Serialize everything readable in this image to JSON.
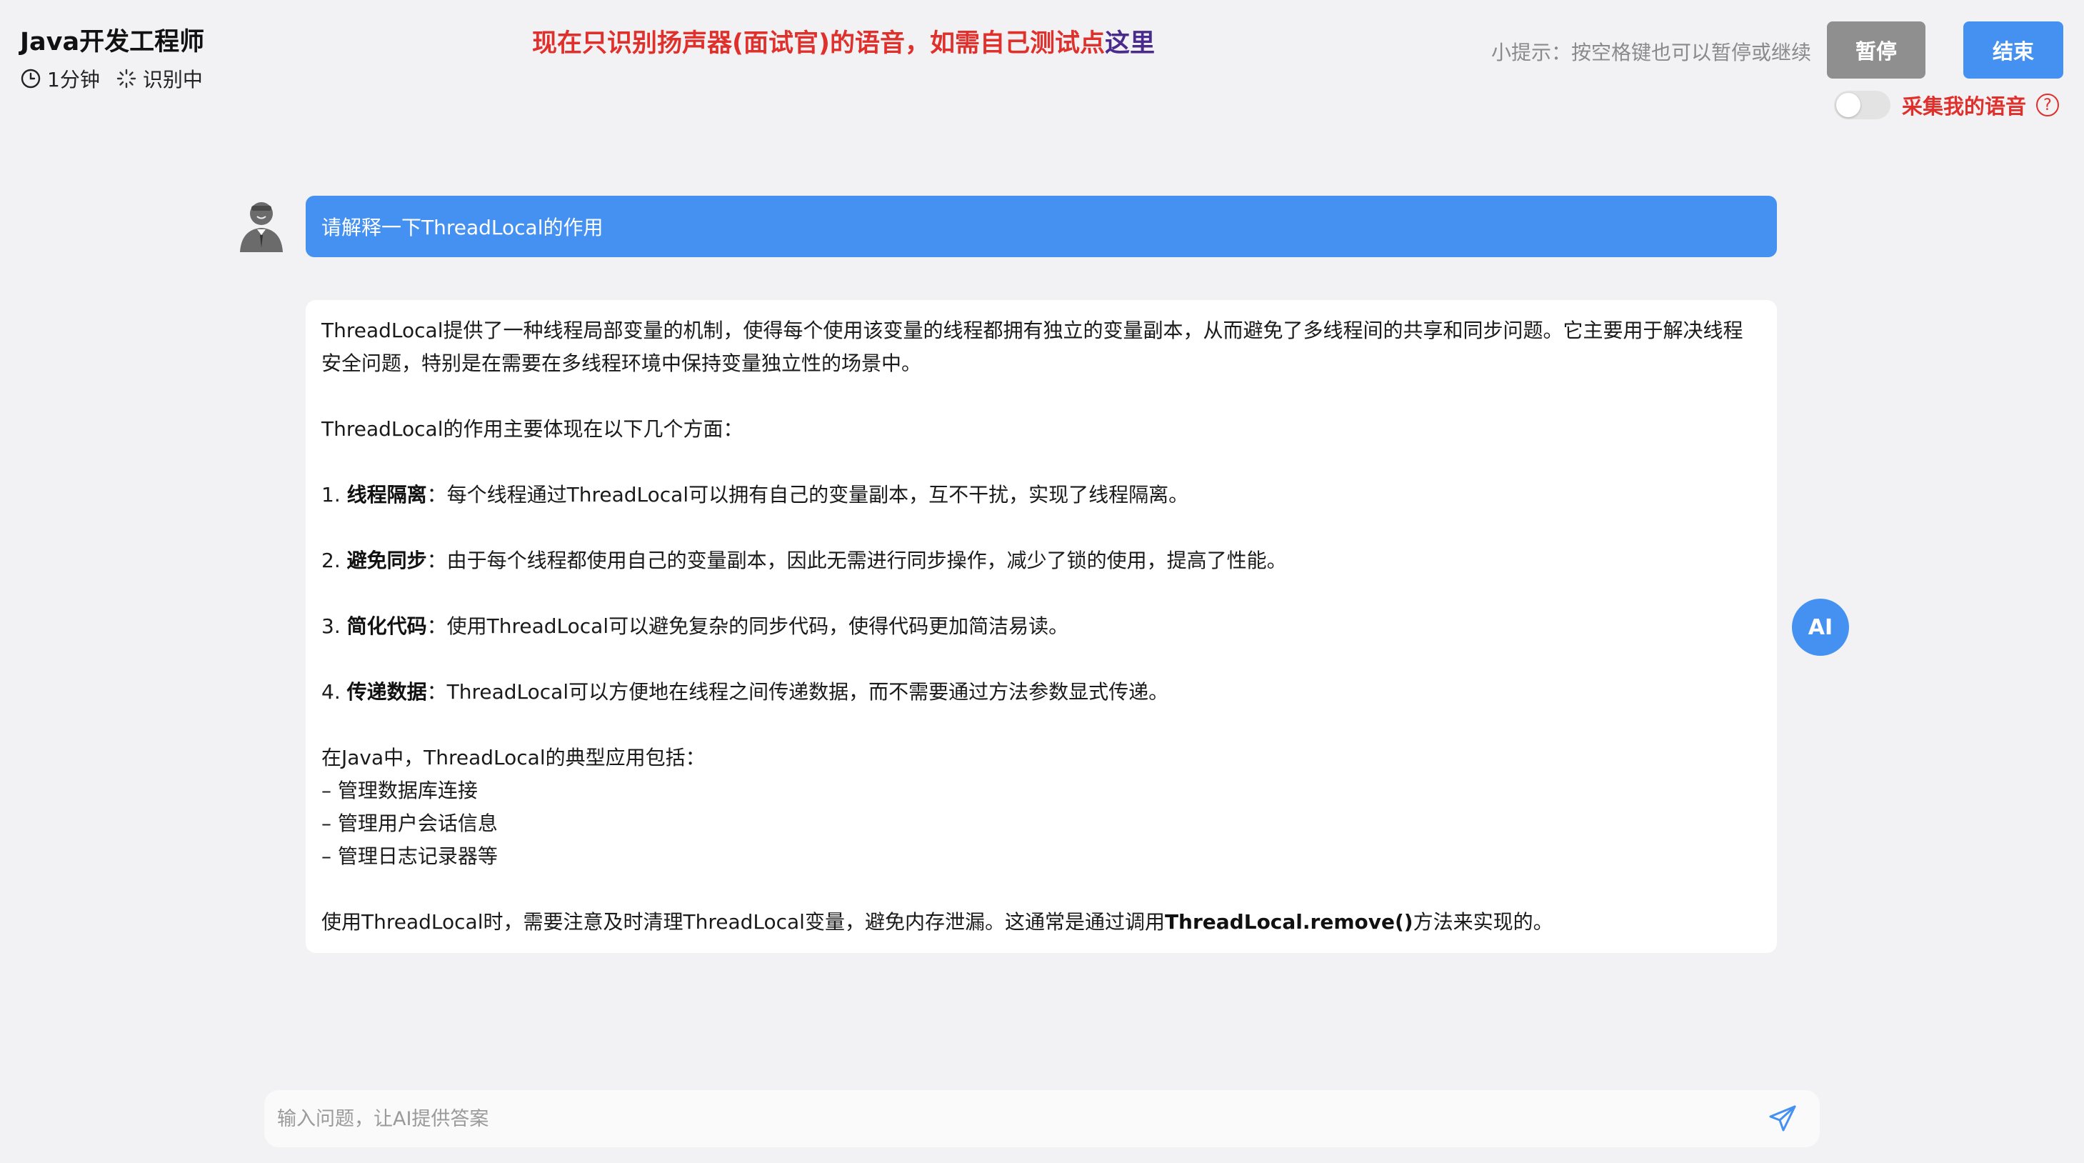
{
  "header": {
    "job_title": "Java开发工程师",
    "duration": "1分钟",
    "status": "识别中",
    "notice_text": "现在只识别扬声器(面试官)的语音，如需自己测试点",
    "notice_link": "这里",
    "tip": "小提示：按空格键也可以暂停或继续",
    "pause_label": "暂停",
    "end_label": "结束",
    "voice_toggle_label": "采集我的语音",
    "voice_toggle_on": false
  },
  "chat": {
    "question": "请解释一下ThreadLocal的作用",
    "answer": {
      "intro": "ThreadLocal提供了一种线程局部变量的机制，使得每个使用该变量的线程都拥有独立的变量副本，从而避免了多线程间的共享和同步问题。它主要用于解决线程安全问题，特别是在需要在多线程环境中保持变量独立性的场景中。",
      "role_heading": "ThreadLocal的作用主要体现在以下几个方面：",
      "points": [
        {
          "num": "1.",
          "title": "线程隔离",
          "text": "：每个线程通过ThreadLocal可以拥有自己的变量副本，互不干扰，实现了线程隔离。"
        },
        {
          "num": "2.",
          "title": "避免同步",
          "text": "：由于每个线程都使用自己的变量副本，因此无需进行同步操作，减少了锁的使用，提高了性能。"
        },
        {
          "num": "3.",
          "title": "简化代码",
          "text": "：使用ThreadLocal可以避免复杂的同步代码，使得代码更加简洁易读。"
        },
        {
          "num": "4.",
          "title": "传递数据",
          "text": "：ThreadLocal可以方便地在线程之间传递数据，而不需要通过方法参数显式传递。"
        }
      ],
      "usage_heading": "在Java中，ThreadLocal的典型应用包括：",
      "usages": [
        "– 管理数据库连接",
        "– 管理用户会话信息",
        "– 管理日志记录器等"
      ],
      "conclusion_pre": "使用ThreadLocal时，需要注意及时清理ThreadLocal变量，避免内存泄漏。这通常是通过调用",
      "conclusion_code": "ThreadLocal.remove()",
      "conclusion_post": "方法来实现的。"
    },
    "ai_label": "AI"
  },
  "input": {
    "placeholder": "输入问题，让AI提供答案",
    "value": ""
  },
  "icons": {
    "duration": "clock-icon",
    "status": "loading-spinner-icon",
    "help": "question-circle-icon",
    "send": "send-paper-plane-icon",
    "user_avatar": "interviewer-avatar-icon"
  },
  "colors": {
    "accent": "#4591f2",
    "alert": "#e0302c",
    "link": "#4a2a8c",
    "pause": "#8f8f8f"
  }
}
